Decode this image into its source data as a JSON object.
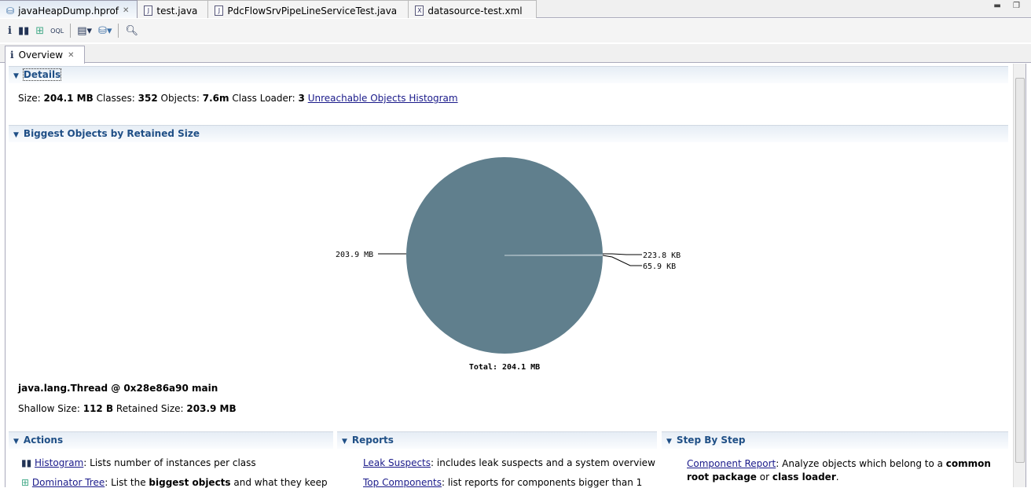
{
  "editor_tabs": [
    {
      "label": "javaHeapDump.hprof",
      "icon": "heap-dump-icon"
    },
    {
      "label": "test.java",
      "icon": "java-file-icon"
    },
    {
      "label": "PdcFlowSrvPipeLineServiceTest.java",
      "icon": "java-file-icon"
    },
    {
      "label": "datasource-test.xml",
      "icon": "xml-file-icon"
    }
  ],
  "subtab": {
    "label": "Overview"
  },
  "details": {
    "title": "Details",
    "size_label": "Size:",
    "size": "204.1 MB",
    "classes_label": "Classes:",
    "classes": "352",
    "objects_label": "Objects:",
    "objects": "7.6m",
    "loader_label": "Class Loader:",
    "loader": "3",
    "link": "Unreachable Objects Histogram"
  },
  "biggest": {
    "title": "Biggest Objects by Retained Size",
    "object": "java.lang.Thread @ 0x28e86a90 main",
    "shallow_label": "Shallow Size:",
    "shallow": "112 B",
    "retained_label": "Retained Size:",
    "retained": "203.9 MB"
  },
  "chart_data": {
    "type": "pie",
    "title": "Total: 204.1 MB",
    "labels": [
      "203.9 MB",
      "223.8 KB",
      "65.9 KB"
    ],
    "values_kb": [
      208793.6,
      223.8,
      65.9
    ],
    "colors": [
      "#607f8d",
      "#8fa7b2",
      "#c9d4da"
    ]
  },
  "actions": {
    "title": "Actions",
    "items": [
      {
        "link": "Histogram",
        "text_a": ": Lists number of instances per class"
      },
      {
        "link": "Dominator Tree",
        "text_a": ": List the ",
        "bold": "biggest objects",
        "text_b": " and what they keep"
      }
    ]
  },
  "reports": {
    "title": "Reports",
    "items": [
      {
        "link": "Leak Suspects",
        "text": ": includes leak suspects and a system overview"
      },
      {
        "link": "Top Components",
        "text": ": list reports for components bigger than 1"
      }
    ]
  },
  "stepbystep": {
    "title": "Step By Step",
    "link": "Component Report",
    "text_a": ": Analyze objects which belong to a ",
    "bold_a": "common root package",
    "text_b": " or ",
    "bold_b": "class loader",
    "text_c": "."
  }
}
